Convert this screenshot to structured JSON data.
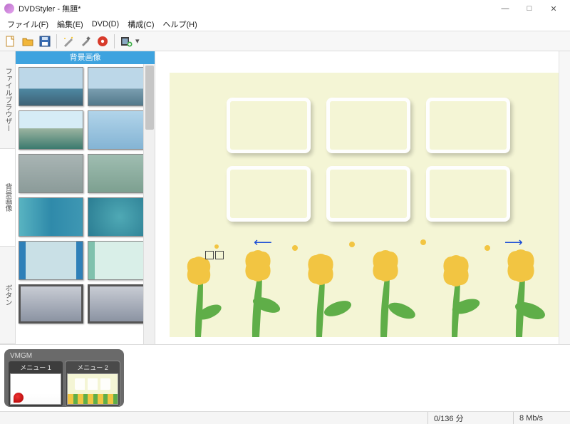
{
  "title": "DVDStyler - 無題*",
  "menu": {
    "file": "ファイル(F)",
    "edit": "編集(E)",
    "dvd": "DVD(D)",
    "config": "構成(C)",
    "help": "ヘルプ(H)"
  },
  "vtabs": {
    "file_browser": "ファイルブラウザー",
    "bg_images": "背景画像",
    "buttons": "ボタン"
  },
  "side_header": "背景画像",
  "vmgm": {
    "title": "VMGM",
    "menu1": "メニュー 1",
    "menu2": "メニュー 2"
  },
  "status": {
    "duration": "0/136 分",
    "bitrate": "8 Mb/s"
  },
  "win": {
    "min": "—",
    "max": "□",
    "close": "✕"
  },
  "icons": {
    "arrow_left": "⟵",
    "arrow_right": "⟶"
  }
}
